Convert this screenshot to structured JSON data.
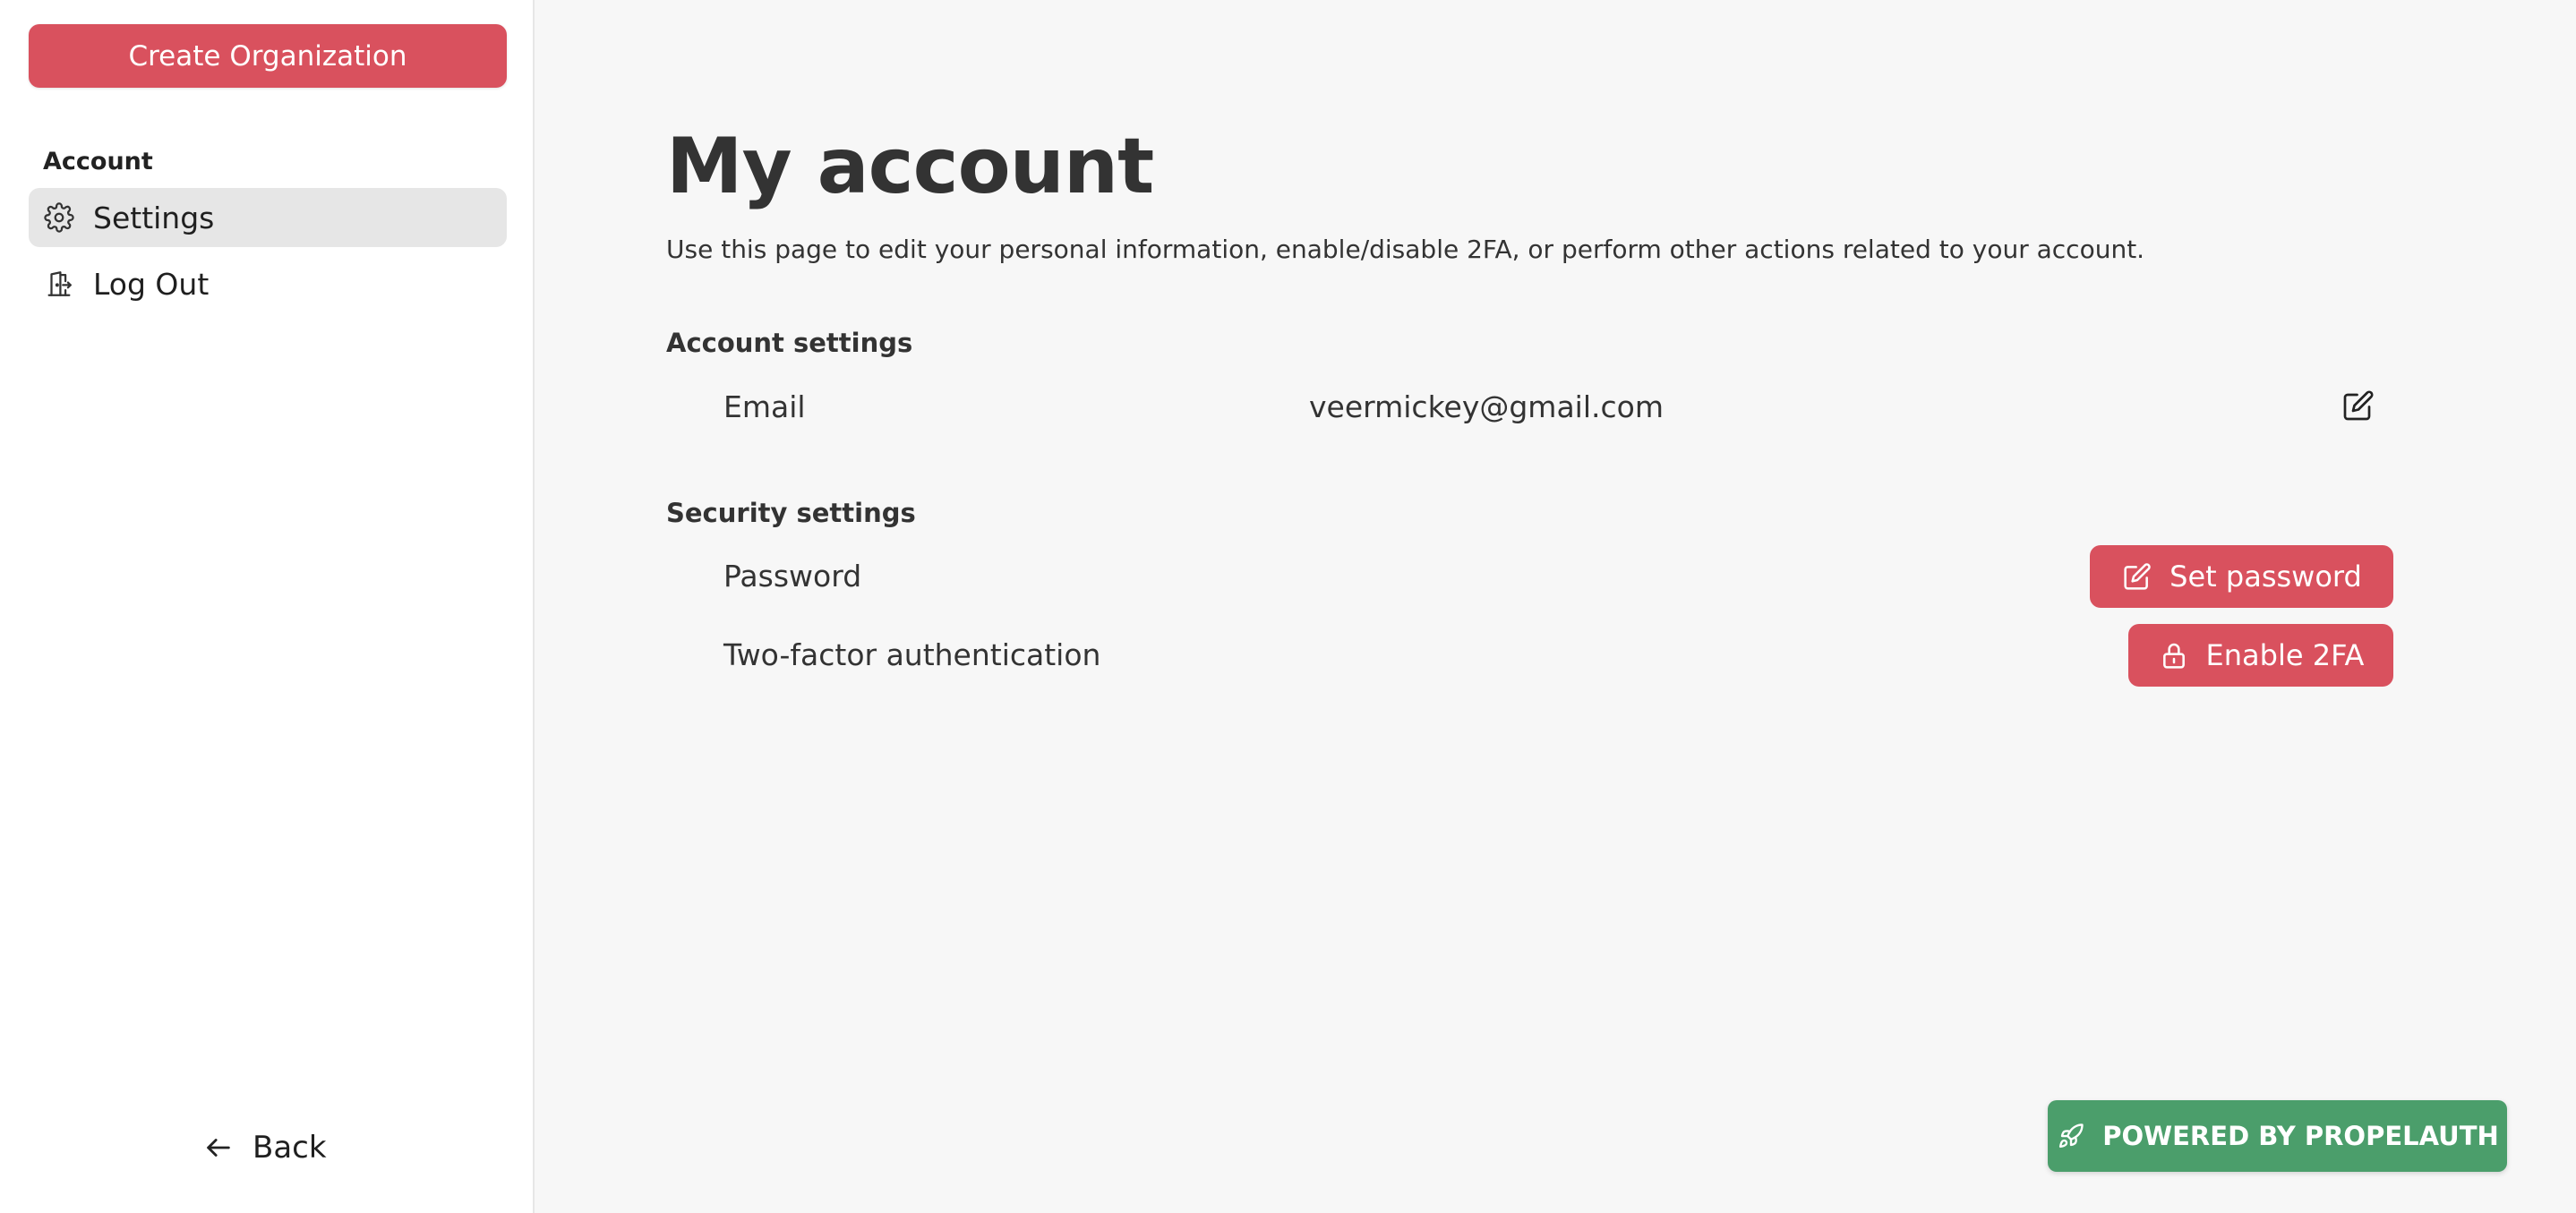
{
  "sidebar": {
    "create_org_label": "Create Organization",
    "section_label": "Account",
    "items": [
      {
        "label": "Settings",
        "icon": "gear-icon",
        "active": true
      },
      {
        "label": "Log Out",
        "icon": "logout-door-icon",
        "active": false
      }
    ],
    "back_label": "Back"
  },
  "main": {
    "title": "My account",
    "subtitle": "Use this page to edit your personal information, enable/disable 2FA, or perform other actions related to your account.",
    "account_settings": {
      "title": "Account settings",
      "email_label": "Email",
      "email_value": "veermickey@gmail.com"
    },
    "security_settings": {
      "title": "Security settings",
      "password_label": "Password",
      "set_password_label": "Set password",
      "twofa_label": "Two-factor authentication",
      "enable_2fa_label": "Enable 2FA"
    }
  },
  "footer": {
    "powered_label": "POWERED BY PROPELAUTH"
  },
  "colors": {
    "primary": "#d9515e",
    "powered": "#4b9e6b",
    "background": "#f7f7f7",
    "sidebar": "#ffffff",
    "active_item": "#e6e6e6",
    "text": "#333333"
  }
}
